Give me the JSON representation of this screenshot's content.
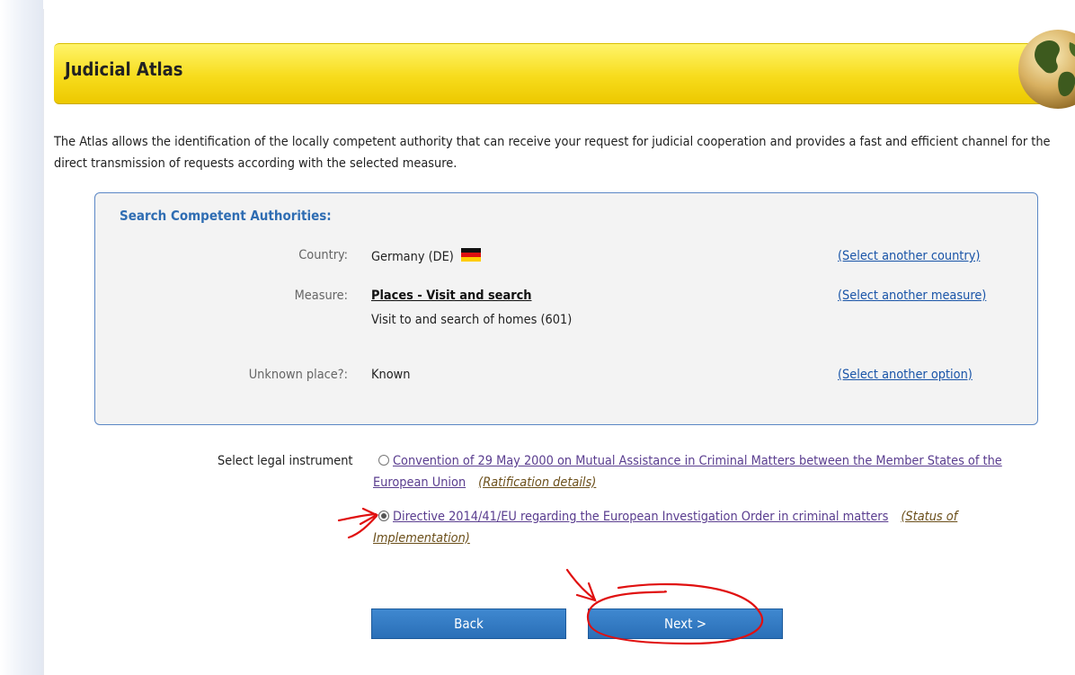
{
  "title": "Judicial Atlas",
  "intro": "The Atlas allows the identification of the locally competent authority that can receive your request for judicial cooperation and provides a fast and efficient channel for the direct transmission of requests according with the selected measure.",
  "search": {
    "heading": "Search Competent Authorities:",
    "country": {
      "label": "Country:",
      "value": "Germany (DE)",
      "flag_icon": "flag-germany-icon",
      "link": "(Select another country)"
    },
    "measure": {
      "label": "Measure:",
      "title": "Places - Visit and search",
      "description": "Visit to and search of homes (601)",
      "link": "(Select another measure)"
    },
    "unknown_place": {
      "label": "Unknown place?:",
      "value": "Known",
      "link": "(Select another option)"
    }
  },
  "legal": {
    "label": "Select legal instrument",
    "options": [
      {
        "text": "Convention of 29 May 2000 on Mutual Assistance in Criminal Matters between the Member States of the European Union",
        "extra": "(Ratification details)",
        "selected": false
      },
      {
        "text": "Directive 2014/41/EU regarding the European Investigation Order in criminal matters",
        "extra": "(Status of Implementation)",
        "selected": true
      }
    ]
  },
  "buttons": {
    "back": "Back",
    "next": "Next >"
  },
  "colors": {
    "title_bar": "#f7dc1c",
    "button": "#2a6fb7",
    "box_border": "#5b87c5",
    "heading": "#2f6db3",
    "link": "#1a55a8",
    "annotation": "#e01010"
  }
}
